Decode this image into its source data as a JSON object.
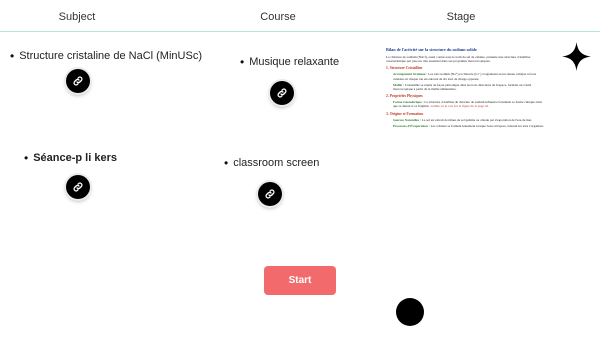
{
  "header": {
    "subject": "Subject",
    "course": "Course",
    "stage": "Stage"
  },
  "subjects": [
    {
      "label": "Structure cristaline de NaCl (MinUSc)",
      "link_icon": "link-icon"
    },
    {
      "label": "Séance-p li kers",
      "link_icon": "link-icon"
    }
  ],
  "courses": [
    {
      "label": "Musique relaxante",
      "link_icon": "link-icon"
    },
    {
      "label": "classroom screen",
      "link_icon": "link-icon"
    }
  ],
  "stage_doc": {
    "title": "Bilan de l'activité sur la structure du sodium solide",
    "intro": "Le chlorure de sodium (NaCl), aussi connu sous le nom de sel de cuisine, présente une structure cristalline caractéristique qui joue un rôle essentiel dans ses propriétés macroscopiques.",
    "sections": [
      {
        "heading": "1. Structure Cristalline",
        "items": [
          {
            "term": "Arrangement Ordonné :",
            "text": "Les ions sodium (Na⁺) et chlorure (Cl⁻) s'organisent en un réseau cubique à faces centrées où chaque ion est entouré de six ions de charge opposée."
          },
          {
            "term": "Maille :",
            "text": "L'ensemble se répète de façon périodique dans les trois directions de l'espace, formant un cristal macroscopique à partir de la maille élémentaire."
          }
        ]
      },
      {
        "heading": "2. Propriétés Physiques",
        "items": [
          {
            "term": "Forme Géométrique :",
            "text": "La structure cristalline du chlorure de sodium influence fortement sa forme cubique ainsi que sa dureté et sa fragilité,",
            "highlight": "comme on le voit sur la figure de la page 42."
          }
        ]
      },
      {
        "heading": "3. Origine et Formation",
        "items": [
          {
            "term": "Sources Naturelles :",
            "text": "Le sel est extrait de mines de sel gemme ou obtenu par évaporation de l'eau de mer."
          },
          {
            "term": "Processus d'Évaporation :",
            "text": "Les cristaux se forment lentement lorsque l'eau s'évapore, laissant les ions s'organiser."
          }
        ]
      }
    ]
  },
  "icons": {
    "sparkle": "sparkle-icon",
    "link": "link-icon"
  },
  "actions": {
    "start_label": "Start"
  },
  "colors": {
    "accent": "#f36a6c",
    "divider": "#b9e6da",
    "doc_title": "#1d3f8f",
    "doc_heading": "#c0392b",
    "doc_term": "#2b7a2b"
  }
}
